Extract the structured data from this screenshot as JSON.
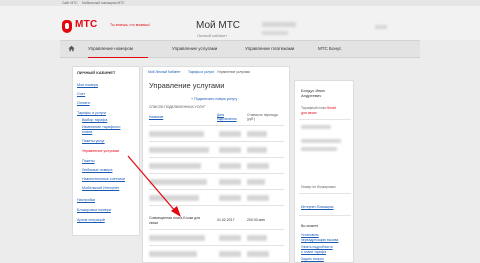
{
  "topbar": {
    "link1": "Сайт МТС",
    "link2": "Мобильный помощник МТС"
  },
  "header": {
    "logo_text": "МТС",
    "slogan": "Ты знаешь, что можешь!",
    "title": "Мой МТС",
    "subtitle": "Личный кабинет"
  },
  "nav": {
    "items": [
      {
        "label": "Управление номером"
      },
      {
        "label": "Управление услугами"
      },
      {
        "label": "Управление платежами"
      },
      {
        "label": "МТС Бонус"
      }
    ]
  },
  "sidebar": {
    "title": "ЛИЧНЫЙ КАБИНЕТ",
    "items": [
      {
        "label": "Мои номера"
      },
      {
        "label": "Счет"
      },
      {
        "label": "Оплата"
      },
      {
        "label": "Тарифы и услуги"
      },
      {
        "label": "Выбор тарифа"
      },
      {
        "label": "Изменение тарифного"
      },
      {
        "label": "плана"
      },
      {
        "label": "Пакеты услуг"
      },
      {
        "label": "Управление услугами"
      },
      {
        "label": "Пакеты"
      },
      {
        "label": "Любимые номера"
      },
      {
        "label": "Накопительные счетчики"
      },
      {
        "label": "Мобильный Интернет"
      },
      {
        "label": "Настройки"
      },
      {
        "label": "Блокировка номера"
      },
      {
        "label": "Архив операций"
      }
    ]
  },
  "main": {
    "breadcrumb": [
      "Мой Личный Кабинет",
      "Тарифы и услуги",
      "Управление услугами"
    ],
    "title": "Управление услугами",
    "connect_link": "+ Подключить новую услугу",
    "list_title": "СПИСОК ПОДКЛЮЧЕННЫХ УСЛУГ",
    "columns": [
      "Название",
      "Дата подключения",
      "Стоимость перехода (руб.)"
    ],
    "highlight_row": {
      "name_line1": "Совмещенная плата Блоки для",
      "name_line2": "связи",
      "date": "01.02.2017",
      "cost": "200.00 мин"
    }
  },
  "right": {
    "name_line1": "Бондус Иван",
    "name_line2": "Андреевич",
    "tariff_label": "Тарифный план:",
    "tariff_value": "Smart",
    "tariff_sub": "для своих",
    "status": "Номер не блокирован",
    "internet_link": "Интернет-Помощник",
    "help_title": "Вы можете",
    "help_links": [
      "Установить",
      "переадресацию вызова",
      "Узнать подробности",
      "о плане тарифа",
      "Задать вопрос",
      "и другие"
    ]
  },
  "colors": {
    "brand_red": "#e30611",
    "link_blue": "#1a5ab5"
  }
}
